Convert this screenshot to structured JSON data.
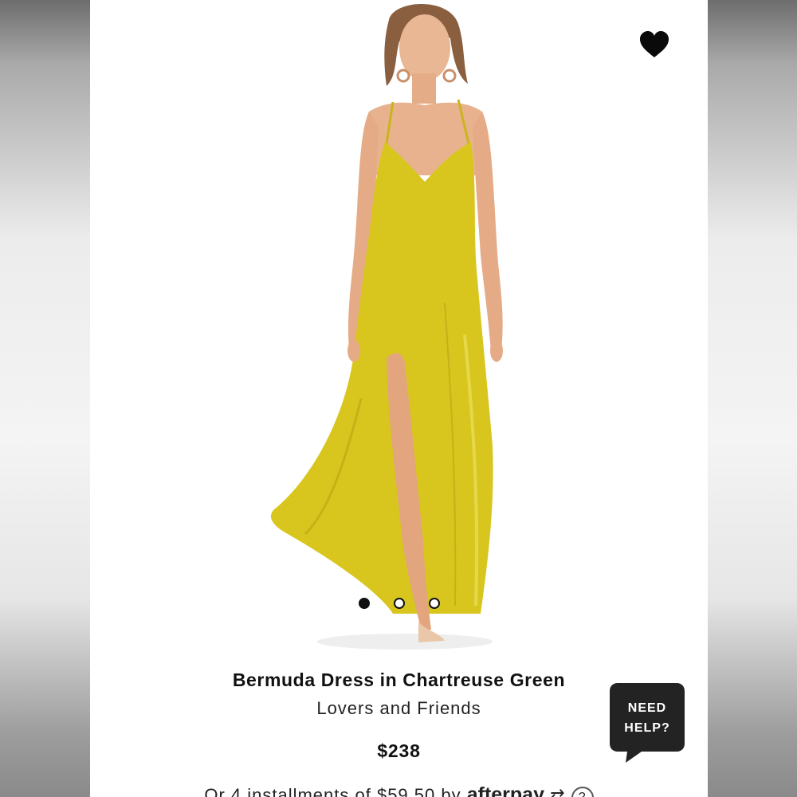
{
  "product": {
    "name": "Bermuda Dress in Chartreuse Green",
    "brand": "Lovers and Friends",
    "price": "$238",
    "installments_text": "Or 4 installments of $59.50 by",
    "installments_provider": "afterpay",
    "installments_info_icon": "?"
  },
  "carousel": {
    "active_index": 0,
    "dot_count": 3
  },
  "favorite": {
    "icon": "heart-icon",
    "state": "favorited"
  },
  "help": {
    "line1": "NEED",
    "line2": "HELP?"
  },
  "colors": {
    "dress": "#d8c61e",
    "accent": "#111111",
    "help_bubble": "#232323"
  }
}
